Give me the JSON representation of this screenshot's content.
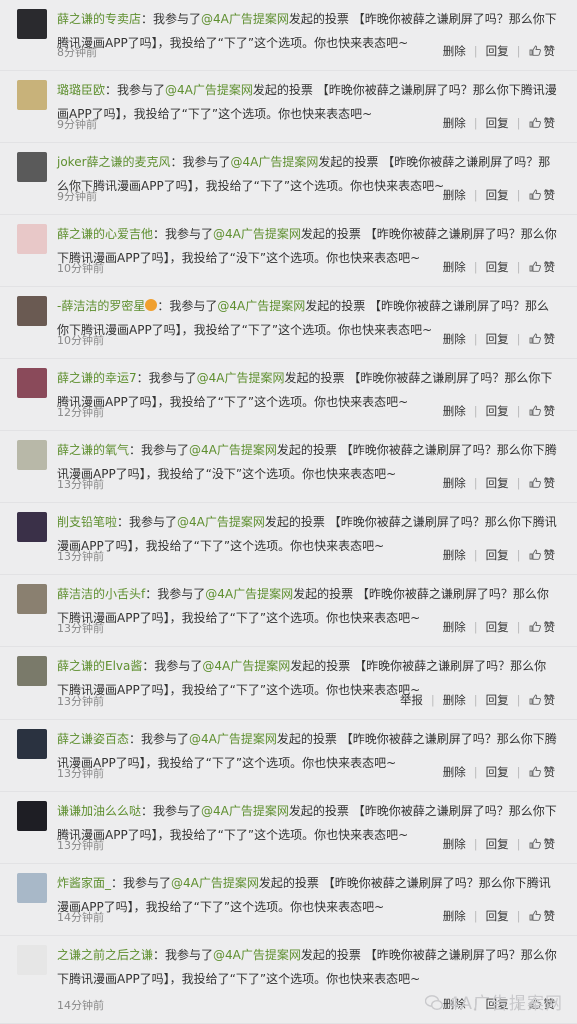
{
  "colors": {
    "link": "#5e8f2f",
    "background": "#ededee",
    "meta": "#888888"
  },
  "watermark": {
    "text": "4A广告提案网",
    "icon": "wechat-icon"
  },
  "comments": [
    {
      "user": "薛之谦的专卖店",
      "pre": "：我参与了",
      "mention": "@4A广告提案网",
      "post": "发起的投票 【昨晚你被薛之谦刷屏了吗？那么你下腾讯漫画APP了吗】，我投给了“下了”这个选项。你也快来表态吧~",
      "time": "8分钟前",
      "report": "",
      "delete": "删除",
      "reply": "回复",
      "like": "赞",
      "avatar_color": "#2a2a2e"
    },
    {
      "user": "璐璐臣欧",
      "pre": "：我参与了",
      "mention": "@4A广告提案网",
      "post": "发起的投票 【昨晚你被薛之谦刷屏了吗？那么你下腾讯漫画APP了吗】，我投给了“下了”这个选项。你也快来表态吧~",
      "time": "9分钟前",
      "report": "",
      "delete": "删除",
      "reply": "回复",
      "like": "赞",
      "avatar_color": "#c8b27a"
    },
    {
      "user": "joker薛之谦的麦克风",
      "pre": "：我参与了",
      "mention": "@4A广告提案网",
      "post": "发起的投票 【昨晚你被薛之谦刷屏了吗？那么你下腾讯漫画APP了吗】，我投给了“下了”这个选项。你也快来表态吧~",
      "time": "9分钟前",
      "report": "",
      "delete": "删除",
      "reply": "回复",
      "like": "赞",
      "avatar_color": "#5a5a5a"
    },
    {
      "user": "薛之谦的心爱吉他",
      "pre": "：我参与了",
      "mention": "@4A广告提案网",
      "post": "发起的投票 【昨晚你被薛之谦刷屏了吗？那么你下腾讯漫画APP了吗】，我投给了“没下”这个选项。你也快来表态吧~",
      "time": "10分钟前",
      "report": "",
      "delete": "删除",
      "reply": "回复",
      "like": "赞",
      "avatar_color": "#e8c8c8"
    },
    {
      "user": "-薛洁洁的罗密星",
      "emoji": true,
      "pre": "：我参与了",
      "mention": "@4A广告提案网",
      "post": "发起的投票 【昨晚你被薛之谦刷屏了吗？那么你下腾讯漫画APP了吗】，我投给了“下了”这个选项。你也快来表态吧~",
      "time": "10分钟前",
      "report": "",
      "delete": "删除",
      "reply": "回复",
      "like": "赞",
      "avatar_color": "#6a5a52"
    },
    {
      "user": "薛之谦的幸运7",
      "pre": "：我参与了",
      "mention": "@4A广告提案网",
      "post": "发起的投票 【昨晚你被薛之谦刷屏了吗？那么你下腾讯漫画APP了吗】，我投给了“下了”这个选项。你也快来表态吧~",
      "time": "12分钟前",
      "report": "",
      "delete": "删除",
      "reply": "回复",
      "like": "赞",
      "avatar_color": "#8a4a5a"
    },
    {
      "user": "薛之谦的氧气",
      "pre": "：我参与了",
      "mention": "@4A广告提案网",
      "post": "发起的投票 【昨晚你被薛之谦刷屏了吗？那么你下腾讯漫画APP了吗】，我投给了“没下”这个选项。你也快来表态吧~",
      "time": "13分钟前",
      "report": "",
      "delete": "删除",
      "reply": "回复",
      "like": "赞",
      "avatar_color": "#b8b8a8"
    },
    {
      "user": "削支铅笔啦",
      "pre": "：我参与了",
      "mention": "@4A广告提案网",
      "post": "发起的投票 【昨晚你被薛之谦刷屏了吗？那么你下腾讯漫画APP了吗】，我投给了“下了”这个选项。你也快来表态吧~",
      "time": "13分钟前",
      "report": "",
      "delete": "删除",
      "reply": "回复",
      "like": "赞",
      "avatar_color": "#3a3048"
    },
    {
      "user": "薛洁洁的小舌头f",
      "pre": "：我参与了",
      "mention": "@4A广告提案网",
      "post": "发起的投票 【昨晚你被薛之谦刷屏了吗？那么你下腾讯漫画APP了吗】，我投给了“下了”这个选项。你也快来表态吧~",
      "time": "13分钟前",
      "report": "",
      "delete": "删除",
      "reply": "回复",
      "like": "赞",
      "avatar_color": "#8a8070"
    },
    {
      "user": "薛之谦的Elva酱",
      "pre": "：我参与了",
      "mention": "@4A广告提案网",
      "post": "发起的投票 【昨晚你被薛之谦刷屏了吗？那么你下腾讯漫画APP了吗】，我投给了“下了”这个选项。你也快来表态吧~",
      "time": "13分钟前",
      "report": "举报",
      "delete": "删除",
      "reply": "回复",
      "like": "赞",
      "avatar_color": "#7a7a6a"
    },
    {
      "user": "薛之谦姿百态",
      "pre": "：我参与了",
      "mention": "@4A广告提案网",
      "post": "发起的投票 【昨晚你被薛之谦刷屏了吗？那么你下腾讯漫画APP了吗】，我投给了“下了”这个选项。你也快来表态吧~",
      "time": "13分钟前",
      "report": "",
      "delete": "删除",
      "reply": "回复",
      "like": "赞",
      "avatar_color": "#2a3240"
    },
    {
      "user": "谦谦加油么么哒",
      "pre": "：我参与了",
      "mention": "@4A广告提案网",
      "post": "发起的投票 【昨晚你被薛之谦刷屏了吗？那么你下腾讯漫画APP了吗】，我投给了“下了”这个选项。你也快来表态吧~",
      "time": "13分钟前",
      "report": "",
      "delete": "删除",
      "reply": "回复",
      "like": "赞",
      "avatar_color": "#1e1e24"
    },
    {
      "user": "炸酱家面_",
      "pre": "：我参与了",
      "mention": "@4A广告提案网",
      "post": "发起的投票 【昨晚你被薛之谦刷屏了吗？那么你下腾讯漫画APP了吗】，我投给了“下了”这个选项。你也快来表态吧~",
      "time": "14分钟前",
      "report": "",
      "delete": "删除",
      "reply": "回复",
      "like": "赞",
      "avatar_color": "#a8b8c8"
    },
    {
      "user": "之谦之前之后之谦",
      "pre": "：我参与了",
      "mention": "@4A广告提案网",
      "post": "发起的投票 【昨晚你被薛之谦刷屏了吗？那么你下腾讯漫画APP了吗】，我投给了“下了”这个选项。你也快来表态吧~",
      "time": "14分钟前",
      "report": "",
      "delete": "删除",
      "reply": "回复",
      "like": "赞",
      "avatar_color": "#e6e6e6"
    }
  ]
}
